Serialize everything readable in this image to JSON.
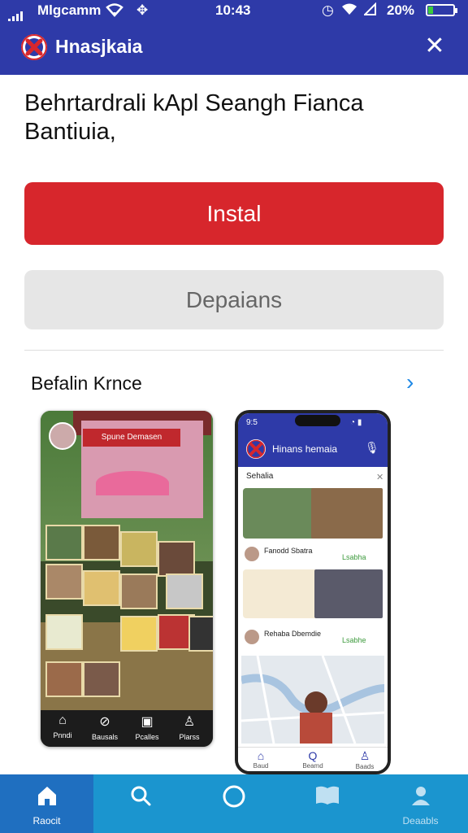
{
  "status_bar": {
    "carrier": "Mlgcamm",
    "time": "10:43",
    "battery": "20%",
    "battery_level": 0.2
  },
  "header": {
    "title": "Hnasjkaia"
  },
  "main": {
    "headline": "Behrtardrali kApl Seangh Fianca Bantiuia,",
    "install_label": "Instal",
    "details_label": "Depaians",
    "section_title": "Befalin Krnce"
  },
  "left_screenshot": {
    "sign_text": "Spune Demasen",
    "nav": [
      "Pnndi",
      "Bausals",
      "Pcalles",
      "Plarss"
    ]
  },
  "right_screenshot": {
    "status_time": "9:5",
    "title": "Hinans hemaia",
    "section": "Sehalia",
    "row1_name": "Fanodd Sbatra",
    "row1_badge": "Lsabha",
    "row2_name": "Rehaba Dbemdie",
    "row2_badge": "Lsabhe",
    "nav": [
      "Baud",
      "Beamd",
      "Baads"
    ]
  },
  "bottom_nav": {
    "items": [
      {
        "label": "Raocit",
        "icon": "home-icon",
        "active": true
      },
      {
        "label": "",
        "icon": "search-icon",
        "active": false
      },
      {
        "label": "",
        "icon": "circle-icon",
        "active": false
      },
      {
        "label": "",
        "icon": "book-icon",
        "active": false
      },
      {
        "label": "Deaabls",
        "icon": "profile-icon",
        "active": false
      }
    ]
  },
  "colors": {
    "primary": "#2e3aa8",
    "install": "#d7262c",
    "tabbar": "#1b95cf",
    "tab_active": "#1f6fc0"
  }
}
